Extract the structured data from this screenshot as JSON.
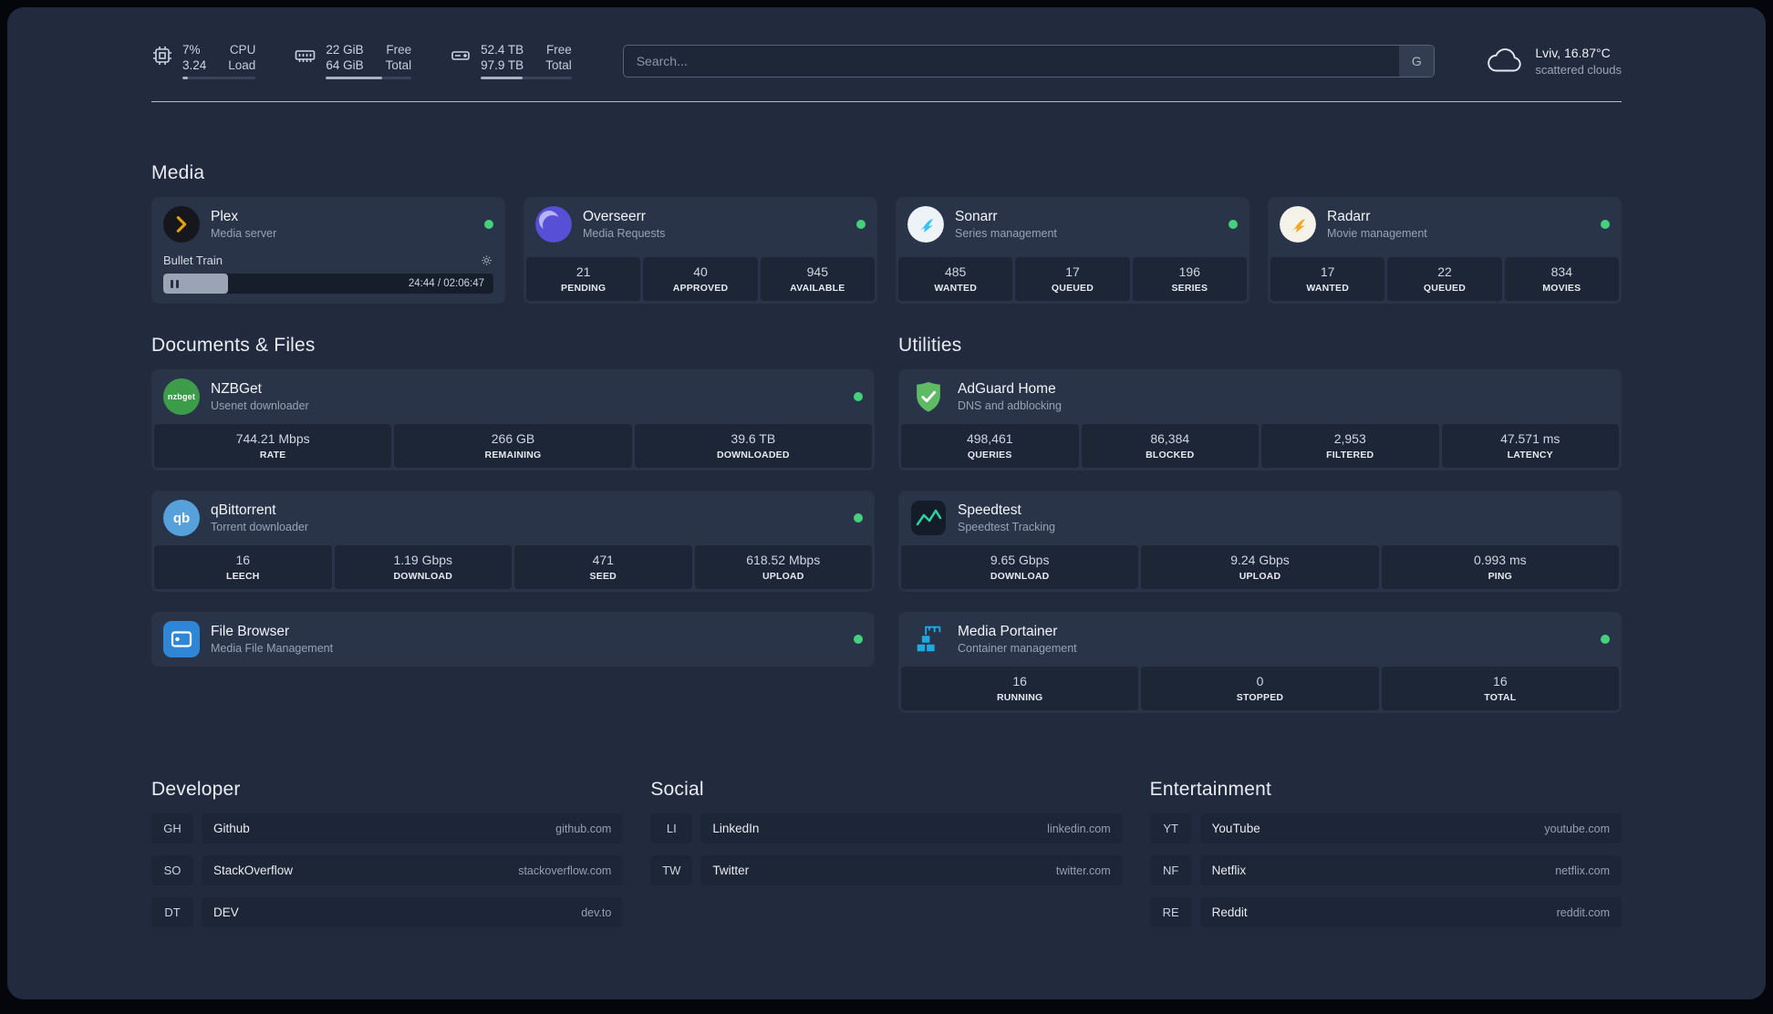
{
  "topbar": {
    "cpu": {
      "value1": "7%",
      "value2": "3.24",
      "label1": "CPU",
      "label2": "Load",
      "percent": 7
    },
    "memory": {
      "value1": "22 GiB",
      "value2": "64 GiB",
      "label1": "Free",
      "label2": "Total",
      "percent": 66
    },
    "disk": {
      "value1": "52.4 TB",
      "value2": "97.9 TB",
      "label1": "Free",
      "label2": "Total",
      "percent": 46
    },
    "search": {
      "placeholder": "Search...",
      "provider": "G"
    },
    "weather": {
      "location": "Lviv, 16.87°C",
      "condition": "scattered clouds"
    }
  },
  "media": {
    "heading": "Media",
    "cards": [
      {
        "title": "Plex",
        "subtitle": "Media server",
        "icon": "plex-icon",
        "status": "online",
        "player": {
          "title": "Bullet Train",
          "time": "24:44 / 02:06:47",
          "percent": 19.5
        }
      },
      {
        "title": "Overseerr",
        "subtitle": "Media Requests",
        "icon": "overseerr-icon",
        "status": "online",
        "stats": [
          {
            "value": "21",
            "label": "PENDING"
          },
          {
            "value": "40",
            "label": "APPROVED"
          },
          {
            "value": "945",
            "label": "AVAILABLE"
          }
        ]
      },
      {
        "title": "Sonarr",
        "subtitle": "Series management",
        "icon": "sonarr-icon",
        "status": "online",
        "stats": [
          {
            "value": "485",
            "label": "WANTED"
          },
          {
            "value": "17",
            "label": "QUEUED"
          },
          {
            "value": "196",
            "label": "SERIES"
          }
        ]
      },
      {
        "title": "Radarr",
        "subtitle": "Movie management",
        "icon": "radarr-icon",
        "status": "online",
        "stats": [
          {
            "value": "17",
            "label": "WANTED"
          },
          {
            "value": "22",
            "label": "QUEUED"
          },
          {
            "value": "834",
            "label": "MOVIES"
          }
        ]
      }
    ]
  },
  "documents": {
    "heading": "Documents & Files",
    "cards": [
      {
        "title": "NZBGet",
        "subtitle": "Usenet downloader",
        "icon": "nzbget-icon",
        "icon_text": "nzbget",
        "status": "online",
        "stats": [
          {
            "value": "744.21 Mbps",
            "label": "RATE"
          },
          {
            "value": "266 GB",
            "label": "REMAINING"
          },
          {
            "value": "39.6 TB",
            "label": "DOWNLOADED"
          }
        ]
      },
      {
        "title": "qBittorrent",
        "subtitle": "Torrent downloader",
        "icon": "qbittorrent-icon",
        "icon_text": "qb",
        "status": "online",
        "stats": [
          {
            "value": "16",
            "label": "LEECH"
          },
          {
            "value": "1.19 Gbps",
            "label": "DOWNLOAD"
          },
          {
            "value": "471",
            "label": "SEED"
          },
          {
            "value": "618.52 Mbps",
            "label": "UPLOAD"
          }
        ]
      },
      {
        "title": "File Browser",
        "subtitle": "Media File Management",
        "icon": "filebrowser-icon",
        "status": "online",
        "stats": []
      }
    ]
  },
  "utilities": {
    "heading": "Utilities",
    "cards": [
      {
        "title": "AdGuard Home",
        "subtitle": "DNS and adblocking",
        "icon": "adguard-icon",
        "stats": [
          {
            "value": "498,461",
            "label": "QUERIES"
          },
          {
            "value": "86,384",
            "label": "BLOCKED"
          },
          {
            "value": "2,953",
            "label": "FILTERED"
          },
          {
            "value": "47.571 ms",
            "label": "LATENCY"
          }
        ]
      },
      {
        "title": "Speedtest",
        "subtitle": "Speedtest Tracking",
        "icon": "speedtest-icon",
        "stats": [
          {
            "value": "9.65 Gbps",
            "label": "DOWNLOAD"
          },
          {
            "value": "9.24 Gbps",
            "label": "UPLOAD"
          },
          {
            "value": "0.993 ms",
            "label": "PING"
          }
        ]
      },
      {
        "title": "Media Portainer",
        "subtitle": "Container management",
        "icon": "portainer-icon",
        "status": "online",
        "stats": [
          {
            "value": "16",
            "label": "RUNNING"
          },
          {
            "value": "0",
            "label": "STOPPED"
          },
          {
            "value": "16",
            "label": "TOTAL"
          }
        ]
      }
    ]
  },
  "bookmarks": [
    {
      "heading": "Developer",
      "items": [
        {
          "abbr": "GH",
          "name": "Github",
          "url": "github.com"
        },
        {
          "abbr": "SO",
          "name": "StackOverflow",
          "url": "stackoverflow.com"
        },
        {
          "abbr": "DT",
          "name": "DEV",
          "url": "dev.to"
        }
      ]
    },
    {
      "heading": "Social",
      "items": [
        {
          "abbr": "LI",
          "name": "LinkedIn",
          "url": "linkedin.com"
        },
        {
          "abbr": "TW",
          "name": "Twitter",
          "url": "twitter.com"
        }
      ]
    },
    {
      "heading": "Entertainment",
      "items": [
        {
          "abbr": "YT",
          "name": "YouTube",
          "url": "youtube.com"
        },
        {
          "abbr": "NF",
          "name": "Netflix",
          "url": "netflix.com"
        },
        {
          "abbr": "RE",
          "name": "Reddit",
          "url": "reddit.com"
        }
      ]
    }
  ],
  "colors": {
    "page_bg": "#212b3d",
    "card_bg": "#2a3449",
    "tile_bg": "#1d2636",
    "status_online": "#43d17c",
    "plex_amber": "#e5a00d",
    "overseerr_purple": "#574fd6",
    "sonarr_blue": "#35c5f4",
    "radarr_amber": "#f5a623",
    "nzbget_green": "#3d9c49",
    "qbittorrent_blue": "#56a0dc",
    "filebrowser_blue": "#2f86d6",
    "adguard_green": "#5fbb63",
    "speedtest_green": "#2dd4a0",
    "portainer_blue": "#1fa9e4"
  }
}
